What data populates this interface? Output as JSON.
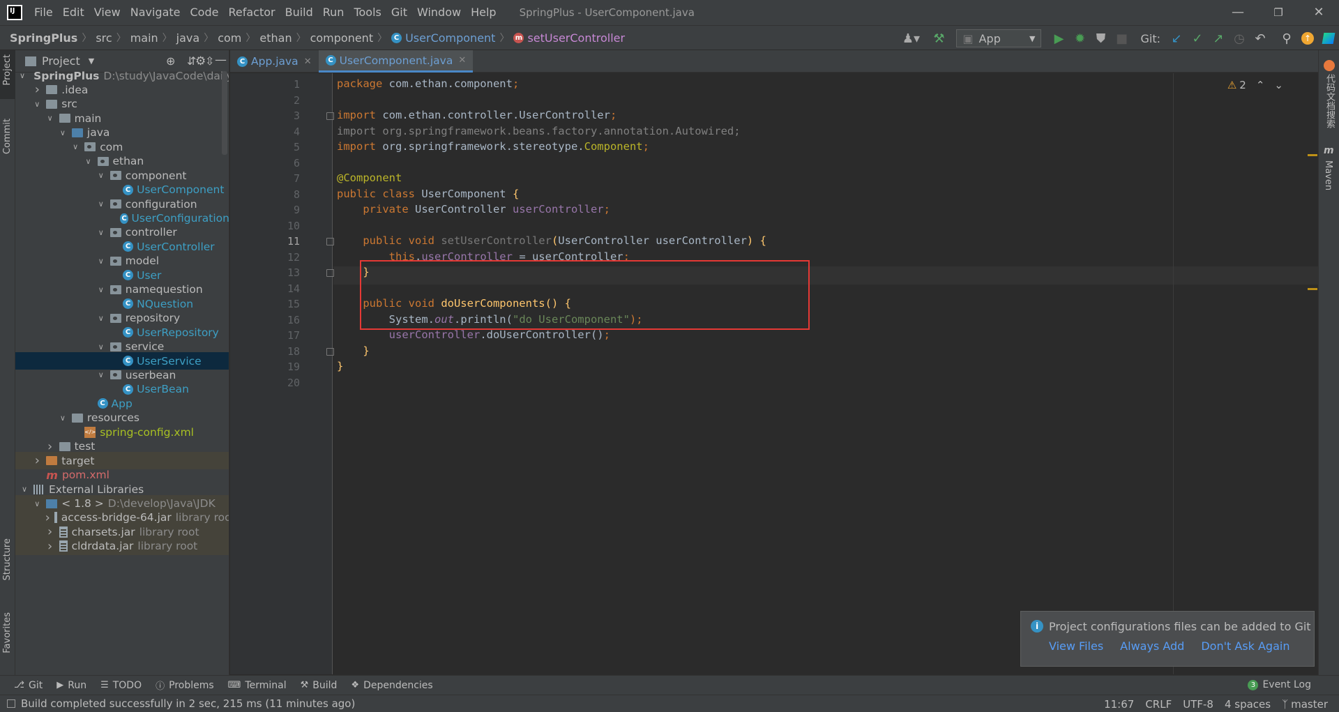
{
  "menubar": {
    "items": [
      "File",
      "Edit",
      "View",
      "Navigate",
      "Code",
      "Refactor",
      "Build",
      "Run",
      "Tools",
      "Git",
      "Window",
      "Help"
    ],
    "window_title": "SpringPlus - UserComponent.java"
  },
  "navbar": {
    "project": "SpringPlus",
    "crumbs": [
      "src",
      "main",
      "java",
      "com",
      "ethan",
      "component"
    ],
    "class_name": "UserComponent",
    "method_name": "setUserController",
    "run_config": "App",
    "git_label": "Git:"
  },
  "left_strip": {
    "project_tab": "Project",
    "commit_tab": "Commit",
    "structure_tab": "Structure",
    "favorites_tab": "Favorites"
  },
  "right_strip": {
    "plugin_tab": "代码文档搜索",
    "maven_tab": "Maven"
  },
  "project_panel": {
    "title": "Project",
    "tree": [
      {
        "label": "SpringPlus",
        "extra": "D:\\study\\JavaCode\\dailyStudy\\S",
        "indent": 0,
        "arrow": "v",
        "icon": "folder",
        "style": "bold"
      },
      {
        "label": ".idea",
        "indent": 1,
        "arrow": ">",
        "icon": "folder"
      },
      {
        "label": "src",
        "indent": 1,
        "arrow": "v",
        "icon": "folder"
      },
      {
        "label": "main",
        "indent": 2,
        "arrow": "v",
        "icon": "folder"
      },
      {
        "label": "java",
        "indent": 3,
        "arrow": "v",
        "icon": "folder-blue"
      },
      {
        "label": "com",
        "indent": 4,
        "arrow": "v",
        "icon": "pkg"
      },
      {
        "label": "ethan",
        "indent": 5,
        "arrow": "v",
        "icon": "pkg"
      },
      {
        "label": "component",
        "indent": 6,
        "arrow": "v",
        "icon": "pkg"
      },
      {
        "label": "UserComponent",
        "indent": 7,
        "arrow": "",
        "icon": "class",
        "style": "cls"
      },
      {
        "label": "configuration",
        "indent": 6,
        "arrow": "v",
        "icon": "pkg"
      },
      {
        "label": "UserConfiguration",
        "indent": 7,
        "arrow": "",
        "icon": "class",
        "style": "cls"
      },
      {
        "label": "controller",
        "indent": 6,
        "arrow": "v",
        "icon": "pkg"
      },
      {
        "label": "UserController",
        "indent": 7,
        "arrow": "",
        "icon": "class",
        "style": "cls"
      },
      {
        "label": "model",
        "indent": 6,
        "arrow": "v",
        "icon": "pkg"
      },
      {
        "label": "User",
        "indent": 7,
        "arrow": "",
        "icon": "class",
        "style": "cls"
      },
      {
        "label": "namequestion",
        "indent": 6,
        "arrow": "v",
        "icon": "pkg"
      },
      {
        "label": "NQuestion",
        "indent": 7,
        "arrow": "",
        "icon": "class",
        "style": "cls"
      },
      {
        "label": "repository",
        "indent": 6,
        "arrow": "v",
        "icon": "pkg"
      },
      {
        "label": "UserRepository",
        "indent": 7,
        "arrow": "",
        "icon": "class",
        "style": "cls"
      },
      {
        "label": "service",
        "indent": 6,
        "arrow": "v",
        "icon": "pkg"
      },
      {
        "label": "UserService",
        "indent": 7,
        "arrow": "",
        "icon": "class",
        "style": "cls",
        "selected": true
      },
      {
        "label": "userbean",
        "indent": 6,
        "arrow": "v",
        "icon": "pkg"
      },
      {
        "label": "UserBean",
        "indent": 7,
        "arrow": "",
        "icon": "class",
        "style": "cls"
      },
      {
        "label": "App",
        "indent": 5,
        "arrow": "",
        "icon": "class",
        "style": "cls"
      },
      {
        "label": "resources",
        "indent": 3,
        "arrow": "v",
        "icon": "folder"
      },
      {
        "label": "spring-config.xml",
        "indent": 4,
        "arrow": "",
        "icon": "xml",
        "style": "xml"
      },
      {
        "label": "test",
        "indent": 2,
        "arrow": ">",
        "icon": "folder"
      },
      {
        "label": "target",
        "indent": 1,
        "arrow": ">",
        "icon": "folder-orange",
        "lib": true
      },
      {
        "label": "pom.xml",
        "indent": 1,
        "arrow": "",
        "icon": "maven",
        "style": "pom"
      },
      {
        "label": "External Libraries",
        "indent": 0,
        "arrow": "v",
        "icon": "lib"
      },
      {
        "label": "< 1.8 >",
        "extra": "D:\\develop\\Java\\JDK",
        "indent": 1,
        "arrow": "v",
        "icon": "jdk",
        "lib": true
      },
      {
        "label": "access-bridge-64.jar",
        "extra": "library root",
        "indent": 2,
        "arrow": ">",
        "icon": "jar",
        "lib": true
      },
      {
        "label": "charsets.jar",
        "extra": "library root",
        "indent": 2,
        "arrow": ">",
        "icon": "jar",
        "lib": true
      },
      {
        "label": "cldrdata.jar",
        "extra": "library root",
        "indent": 2,
        "arrow": ">",
        "icon": "jar",
        "lib": true
      }
    ]
  },
  "tabs": [
    {
      "label": "App.java",
      "active": false
    },
    {
      "label": "UserComponent.java",
      "active": true
    }
  ],
  "editor": {
    "warning_count": "2",
    "current_line": 11,
    "lines": [
      [
        {
          "t": "package ",
          "c": "kw"
        },
        {
          "t": "com.ethan.component",
          "c": ""
        },
        {
          "t": ";",
          "c": "kw"
        }
      ],
      [],
      [
        {
          "t": "import ",
          "c": "kw"
        },
        {
          "t": "com.ethan.controller.UserController",
          "c": ""
        },
        {
          "t": ";",
          "c": "kw"
        }
      ],
      [
        {
          "t": "import org.springframework.beans.factory.annotation.Autowired;",
          "c": "unused"
        }
      ],
      [
        {
          "t": "import ",
          "c": "kw"
        },
        {
          "t": "org.springframework.stereotype.",
          "c": ""
        },
        {
          "t": "Component",
          "c": "ann"
        },
        {
          "t": ";",
          "c": "kw"
        }
      ],
      [],
      [
        {
          "t": "@Component",
          "c": "ann"
        }
      ],
      [
        {
          "t": "public class ",
          "c": "kw"
        },
        {
          "t": "UserComponent ",
          "c": ""
        },
        {
          "t": "{",
          "c": "mth"
        }
      ],
      [
        {
          "t": "    private ",
          "c": "kw"
        },
        {
          "t": "UserController ",
          "c": ""
        },
        {
          "t": "userController",
          "c": "fld"
        },
        {
          "t": ";",
          "c": "kw"
        }
      ],
      [],
      [
        {
          "t": "    public void ",
          "c": "kw"
        },
        {
          "t": "setUserController",
          "c": "grayed"
        },
        {
          "t": "(",
          "c": "mth"
        },
        {
          "t": "UserController userController",
          "c": ""
        },
        {
          "t": ") ",
          "c": "mth"
        },
        {
          "t": "{",
          "c": "mth"
        }
      ],
      [
        {
          "t": "        this",
          "c": "kw"
        },
        {
          "t": ".",
          "c": ""
        },
        {
          "t": "userController",
          "c": "fld"
        },
        {
          "t": " = userController",
          "c": ""
        },
        {
          "t": ";",
          "c": "kw"
        }
      ],
      [
        {
          "t": "    }",
          "c": "mth"
        }
      ],
      [],
      [
        {
          "t": "    public void ",
          "c": "kw"
        },
        {
          "t": "doUserComponents",
          "c": "mth"
        },
        {
          "t": "() {",
          "c": "mth"
        }
      ],
      [
        {
          "t": "        System.",
          "c": ""
        },
        {
          "t": "out",
          "c": "stat"
        },
        {
          "t": ".println(",
          "c": ""
        },
        {
          "t": "\"do UserComponent\"",
          "c": "str"
        },
        {
          "t": ");",
          "c": "kw"
        }
      ],
      [
        {
          "t": "        userController",
          "c": "fld"
        },
        {
          "t": ".doUserController()",
          "c": ""
        },
        {
          "t": ";",
          "c": "kw"
        }
      ],
      [
        {
          "t": "    }",
          "c": "mth"
        }
      ],
      [
        {
          "t": "}",
          "c": "mth"
        }
      ],
      []
    ]
  },
  "bottom_tools": [
    "Git",
    "Run",
    "TODO",
    "Problems",
    "Terminal",
    "Build",
    "Dependencies"
  ],
  "event_log": {
    "label": "Event Log",
    "count": "3"
  },
  "status": {
    "message": "Build completed successfully in 2 sec, 215 ms (11 minutes ago)",
    "position": "11:67",
    "line_sep": "CRLF",
    "encoding": "UTF-8",
    "indent": "4 spaces",
    "branch": "master"
  },
  "notification": {
    "text": "Project configurations files can be added to Git",
    "actions": [
      "View Files",
      "Always Add",
      "Don't Ask Again"
    ]
  }
}
